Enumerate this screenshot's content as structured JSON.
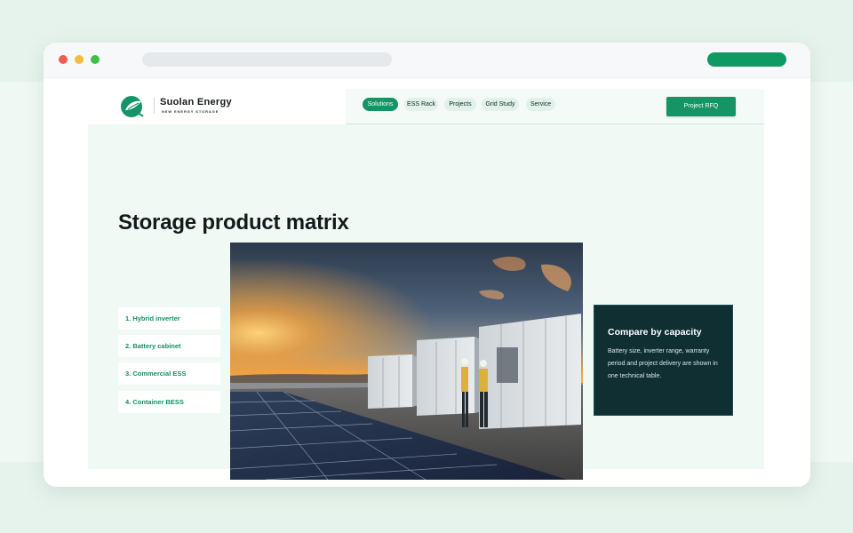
{
  "brand": {
    "name": "Suolan Energy",
    "tagline": "NEW ENERGY STORAGE",
    "accent": "#169466"
  },
  "nav": {
    "items": [
      {
        "label": "Solutions",
        "active": true
      },
      {
        "label": "ESS Rack",
        "active": false
      },
      {
        "label": "Projects",
        "active": false
      },
      {
        "label": "Grid Study",
        "active": false
      },
      {
        "label": "Service",
        "active": false
      }
    ],
    "cta_label": "Project RFQ"
  },
  "main": {
    "title": "Storage product matrix",
    "products": [
      {
        "label": "1. Hybrid inverter"
      },
      {
        "label": "2. Battery cabinet"
      },
      {
        "label": "3. Commercial ESS"
      },
      {
        "label": "4. Container BESS"
      }
    ],
    "hero_image": {
      "icon": "battery-storage-site-photo"
    },
    "card": {
      "title": "Compare by capacity",
      "body": "Battery size, inverter range, warranty period and project delivery are shown in one technical table."
    }
  },
  "colors": {
    "card_background": "#0f2f33",
    "page_background": "#f1f9f5"
  }
}
